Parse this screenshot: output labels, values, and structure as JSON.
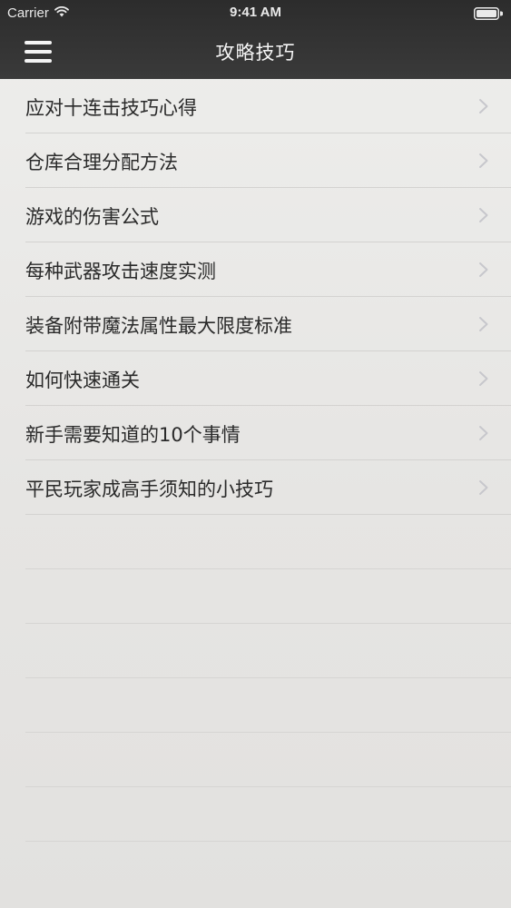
{
  "status_bar": {
    "carrier": "Carrier",
    "time": "9:41 AM",
    "wifi_icon": "wifi-icon",
    "battery_icon": "battery-full-icon"
  },
  "nav": {
    "title": "攻略技巧",
    "menu_icon": "hamburger-menu-icon"
  },
  "list": {
    "items": [
      {
        "label": "应对十连击技巧心得"
      },
      {
        "label": "仓库合理分配方法"
      },
      {
        "label": "游戏的伤害公式"
      },
      {
        "label": "每种武器攻击速度实测"
      },
      {
        "label": "装备附带魔法属性最大限度标准"
      },
      {
        "label": "如何快速通关"
      },
      {
        "label": "新手需要知道的10个事情"
      },
      {
        "label": "平民玩家成高手须知的小技巧"
      }
    ],
    "chevron_icon": "chevron-right-icon"
  },
  "colors": {
    "nav_background": "#333333",
    "nav_text": "#f5f5f5",
    "list_background": "#e8e7e5",
    "row_text": "#2a2a2a",
    "separator": "#d3d2d0",
    "chevron": "#c7c7cc"
  }
}
